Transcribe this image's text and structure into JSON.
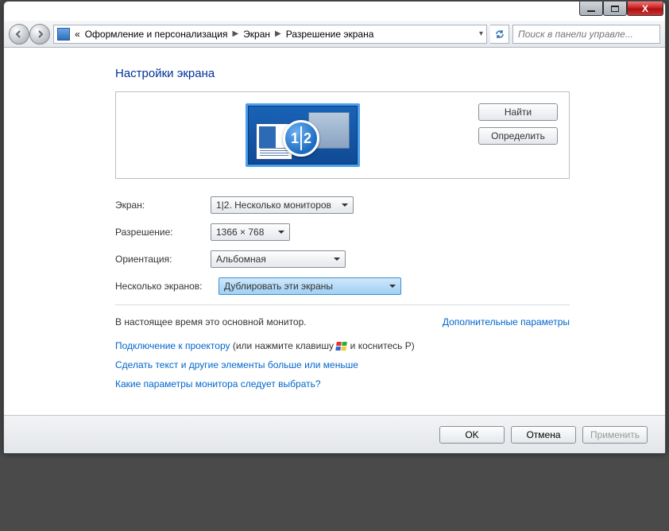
{
  "titlebar": {
    "min": "_",
    "max": "□",
    "close": "X"
  },
  "breadcrumb": {
    "root_prefix": "«",
    "level1": "Оформление и персонализация",
    "level2": "Экран",
    "level3": "Разрешение экрана"
  },
  "search": {
    "placeholder": "Поиск в панели управле..."
  },
  "page_title": "Настройки экрана",
  "preview": {
    "badge1": "1",
    "badge2": "2",
    "find_btn": "Найти",
    "identify_btn": "Определить"
  },
  "form": {
    "screen_label": "Экран:",
    "screen_value": "1|2. Несколько мониторов",
    "resolution_label": "Разрешение:",
    "resolution_value": "1366 × 768",
    "orientation_label": "Ориентация:",
    "orientation_value": "Альбомная",
    "multi_label": "Несколько экранов:",
    "multi_value": "Дублировать эти экраны"
  },
  "status": {
    "main_monitor_text": "В настоящее время это основной монитор.",
    "advanced_link": "Дополнительные параметры"
  },
  "links": {
    "projector_link": "Подключение к проектору",
    "projector_suffix_pre": " (или нажмите клавишу ",
    "projector_suffix_post": " и коснитесь P)",
    "text_size_link": "Сделать текст и другие элементы больше или меньше",
    "which_params_link": "Какие параметры монитора следует выбрать?"
  },
  "footer": {
    "ok": "OK",
    "cancel": "Отмена",
    "apply": "Применить"
  }
}
